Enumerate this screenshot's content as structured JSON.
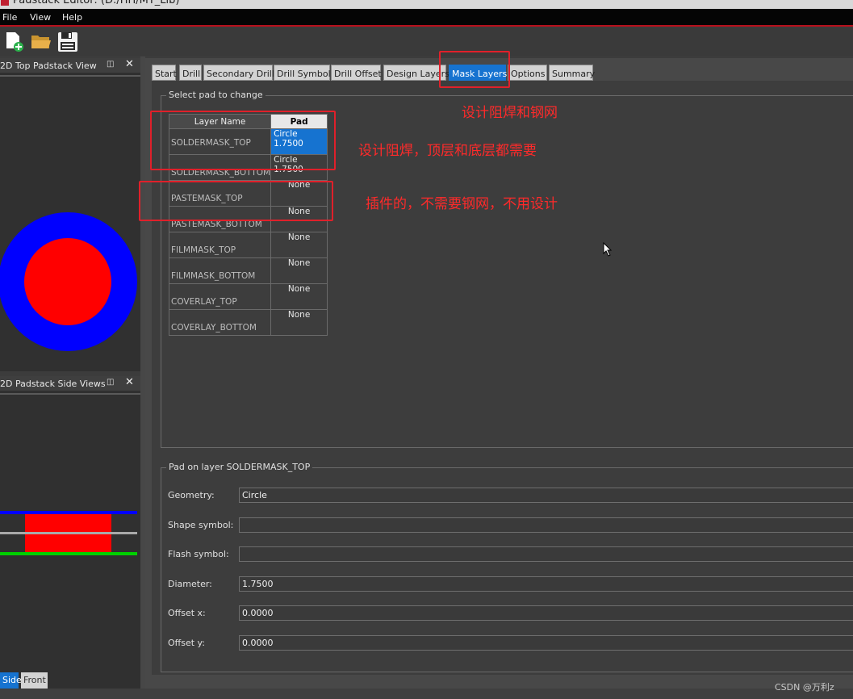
{
  "window": {
    "title": "Padstack Editor:  (D:/HH/MY_Lib)"
  },
  "menu": {
    "file": "File",
    "view": "View",
    "help": "Help"
  },
  "toolbar": {
    "new_icon": "new-file-icon",
    "open_icon": "open-folder-icon",
    "save_icon": "save-disk-icon"
  },
  "top_view": {
    "title": "2D Top Padstack View",
    "outer_color": "#0000ff",
    "inner_color": "#ff0000"
  },
  "side_view": {
    "title": "2D Padstack Side Views",
    "tabs": [
      "Side",
      "Front"
    ],
    "active_tab": "Side"
  },
  "tabs": [
    "Start",
    "Drill",
    "Secondary Drill",
    "Drill Symbol",
    "Drill Offset",
    "Design Layers",
    "Mask Layers",
    "Options",
    "Summary"
  ],
  "active_tab": "Mask Layers",
  "select_pad": {
    "group_title": "Select pad to change",
    "col_layer": "Layer Name",
    "col_pad": "Pad",
    "rows": [
      {
        "layer": "SOLDERMASK_TOP",
        "pad": "Circle 1.7500"
      },
      {
        "layer": "SOLDERMASK_BOTTOM",
        "pad": "Circle 1.7500"
      },
      {
        "layer": "PASTEMASK_TOP",
        "pad": "None"
      },
      {
        "layer": "PASTEMASK_BOTTOM",
        "pad": "None"
      },
      {
        "layer": "FILMMASK_TOP",
        "pad": "None"
      },
      {
        "layer": "FILMMASK_BOTTOM",
        "pad": "None"
      },
      {
        "layer": "COVERLAY_TOP",
        "pad": "None"
      },
      {
        "layer": "COVERLAY_BOTTOM",
        "pad": "None"
      }
    ]
  },
  "pad_props": {
    "group_title": "Pad on layer SOLDERMASK_TOP",
    "geometry_label": "Geometry:",
    "geometry": "Circle",
    "shape_label": "Shape symbol:",
    "shape": "",
    "flash_label": "Flash symbol:",
    "flash": "",
    "diameter_label": "Diameter:",
    "diameter": "1.7500",
    "offx_label": "Offset x:",
    "offx": "0.0000",
    "offy_label": "Offset y:",
    "offy": "0.0000"
  },
  "annotations": {
    "a1": "设计阻焊和钢网",
    "a2": "设计阻焊，顶层和底层都需要",
    "a3": "插件的，不需要钢网，不用设计",
    "color": "#ff2a2a"
  },
  "watermark": "CSDN @万利z"
}
